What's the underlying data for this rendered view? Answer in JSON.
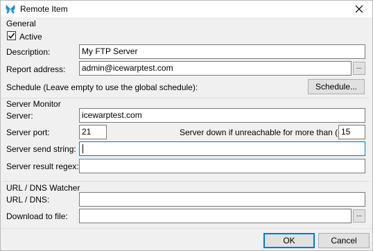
{
  "window": {
    "title": "Remote Item",
    "close_icon": "close-icon",
    "app_icon": "butterfly-icon"
  },
  "general": {
    "header": "General",
    "active_label": "Active",
    "active_checked": true,
    "description_label": "Description:",
    "description_value": "My FTP Server",
    "report_label": "Report address:",
    "report_value": "admin@icewarptest.com",
    "browse_label": "...",
    "schedule_label": "Schedule (Leave empty to use the global schedule):",
    "schedule_button": "Schedule..."
  },
  "server_monitor": {
    "header": "Server Monitor",
    "server_label": "Server:",
    "server_value": "icewarptest.com",
    "port_label": "Server port:",
    "port_value": "21",
    "down_label": "Server down if unreachable for more than (Min):",
    "down_value": "15",
    "send_label": "Server send string:",
    "send_value": "",
    "regex_label": "Server result regex:",
    "regex_value": ""
  },
  "url_watcher": {
    "header": "URL / DNS Watcher",
    "url_label": "URL / DNS:",
    "url_value": "",
    "download_label": "Download to file:",
    "download_value": "",
    "browse_label": "..."
  },
  "footer": {
    "ok_label": "OK",
    "cancel_label": "Cancel"
  },
  "colors": {
    "accent": "#0078d7",
    "icon_blue": "#1e90d8"
  }
}
